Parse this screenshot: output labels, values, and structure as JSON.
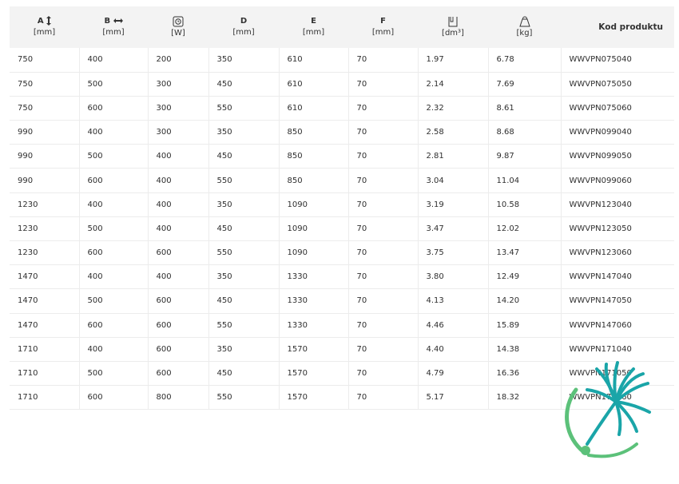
{
  "table": {
    "headers": [
      {
        "label": "A",
        "unit": "[mm]",
        "icon": "vertical-arrow-icon"
      },
      {
        "label": "B",
        "unit": "[mm]",
        "icon": "horizontal-arrow-icon"
      },
      {
        "label": "",
        "unit": "[W]",
        "icon": "power-icon"
      },
      {
        "label": "D",
        "unit": "[mm]"
      },
      {
        "label": "E",
        "unit": "[mm]"
      },
      {
        "label": "F",
        "unit": "[mm]"
      },
      {
        "label": "",
        "unit": "[dm³]",
        "icon": "volume-icon"
      },
      {
        "label": "",
        "unit": "[kg]",
        "icon": "weight-icon"
      },
      {
        "label": "Kod produktu",
        "unit": ""
      }
    ],
    "rows": [
      [
        "750",
        "400",
        "200",
        "350",
        "610",
        "70",
        "1.97",
        "6.78",
        "WWVPN075040"
      ],
      [
        "750",
        "500",
        "300",
        "450",
        "610",
        "70",
        "2.14",
        "7.69",
        "WWVPN075050"
      ],
      [
        "750",
        "600",
        "300",
        "550",
        "610",
        "70",
        "2.32",
        "8.61",
        "WWVPN075060"
      ],
      [
        "990",
        "400",
        "300",
        "350",
        "850",
        "70",
        "2.58",
        "8.68",
        "WWVPN099040"
      ],
      [
        "990",
        "500",
        "400",
        "450",
        "850",
        "70",
        "2.81",
        "9.87",
        "WWVPN099050"
      ],
      [
        "990",
        "600",
        "400",
        "550",
        "850",
        "70",
        "3.04",
        "11.04",
        "WWVPN099060"
      ],
      [
        "1230",
        "400",
        "400",
        "350",
        "1090",
        "70",
        "3.19",
        "10.58",
        "WWVPN123040"
      ],
      [
        "1230",
        "500",
        "400",
        "450",
        "1090",
        "70",
        "3.47",
        "12.02",
        "WWVPN123050"
      ],
      [
        "1230",
        "600",
        "600",
        "550",
        "1090",
        "70",
        "3.75",
        "13.47",
        "WWVPN123060"
      ],
      [
        "1470",
        "400",
        "400",
        "350",
        "1330",
        "70",
        "3.80",
        "12.49",
        "WWVPN147040"
      ],
      [
        "1470",
        "500",
        "600",
        "450",
        "1330",
        "70",
        "4.13",
        "14.20",
        "WWVPN147050"
      ],
      [
        "1470",
        "600",
        "600",
        "550",
        "1330",
        "70",
        "4.46",
        "15.89",
        "WWVPN147060"
      ],
      [
        "1710",
        "400",
        "600",
        "350",
        "1570",
        "70",
        "4.40",
        "14.38",
        "WWVPN171040"
      ],
      [
        "1710",
        "500",
        "600",
        "450",
        "1570",
        "70",
        "4.79",
        "16.36",
        "WWVPN171050"
      ],
      [
        "1710",
        "600",
        "800",
        "550",
        "1570",
        "70",
        "5.17",
        "18.32",
        "WWVPN171060"
      ]
    ]
  },
  "colors": {
    "header_bg": "#f3f3f3",
    "logo_teal": "#1aa5a8",
    "logo_green": "#5cc17a"
  },
  "logo": {
    "icon": "dandelion-logo-icon"
  }
}
